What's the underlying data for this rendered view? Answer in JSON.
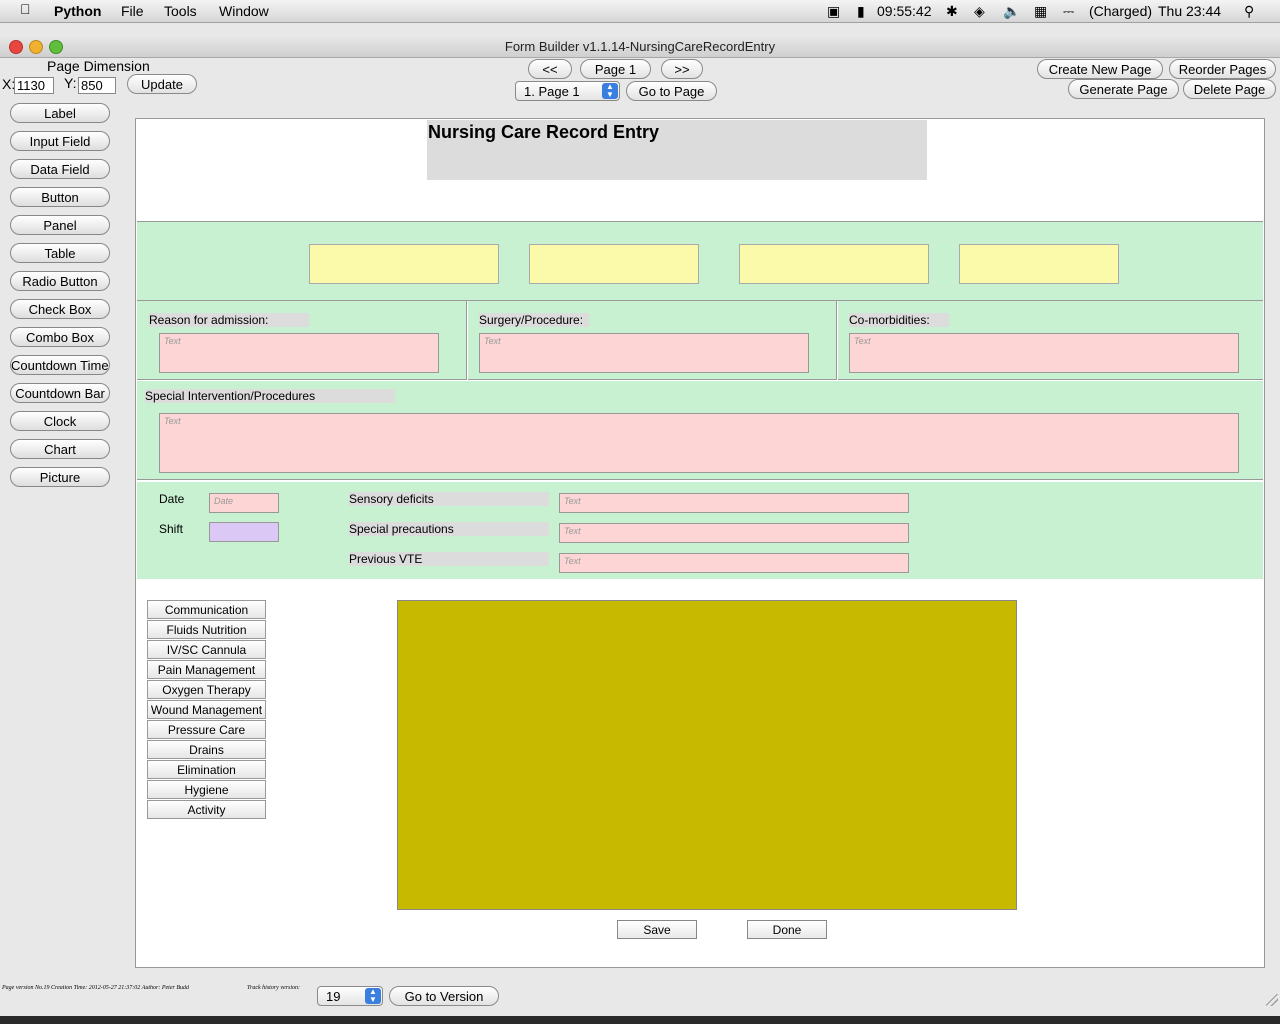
{
  "menubar": {
    "app": "Python",
    "items": [
      "File",
      "Tools",
      "Window"
    ],
    "status": {
      "battery_time": "09:55:42",
      "battery_state": "(Charged)",
      "clock": "Thu 23:44"
    }
  },
  "window": {
    "title": "Form Builder v1.1.14-NursingCareRecordEntry"
  },
  "page_dimension": {
    "label": "Page Dimension",
    "x_label": "X:",
    "x_value": "1130",
    "y_label": "Y:",
    "y_value": "850",
    "update": "Update"
  },
  "nav": {
    "prev": "<<",
    "page": "Page 1",
    "next": ">>",
    "select_value": "1. Page 1",
    "goto": "Go to Page"
  },
  "page_actions": {
    "create": "Create New Page",
    "reorder": "Reorder Pages",
    "generate": "Generate Page",
    "delete": "Delete Page"
  },
  "palette": [
    "Label",
    "Input Field",
    "Data Field",
    "Button",
    "Panel",
    "Table",
    "Radio Button",
    "Check Box",
    "Combo Box",
    "Countdown Timer",
    "Countdown Bar",
    "Clock",
    "Chart",
    "Picture"
  ],
  "form": {
    "title": "Nursing Care Record Entry",
    "reason_label": "Reason for admission:",
    "surgery_label": "Surgery/Procedure:",
    "comorbid_label": "Co-morbidities:",
    "special_label": "Special Intervention/Procedures",
    "text_placeholder": "Text",
    "date_label": "Date",
    "date_placeholder": "Date",
    "shift_label": "Shift",
    "sensory_label": "Sensory deficits",
    "precautions_label": "Special precautions",
    "vte_label": "Previous VTE",
    "side_nav": [
      "Communication",
      "Fluids  Nutrition",
      "IV/SC Cannula",
      "Pain Management",
      "Oxygen Therapy",
      "Wound Management",
      "Pressure Care",
      "Drains",
      "Elimination",
      "Hygiene",
      "Activity"
    ],
    "save": "Save",
    "done": "Done",
    "panel_color": "#c6b900"
  },
  "footer": {
    "info": "Page version No.19   Creation Time: 2012-05-27 21:37:02   Author: Peter Budd",
    "history_label": "Track history version:",
    "version_value": "19",
    "goto_version": "Go to Version"
  }
}
